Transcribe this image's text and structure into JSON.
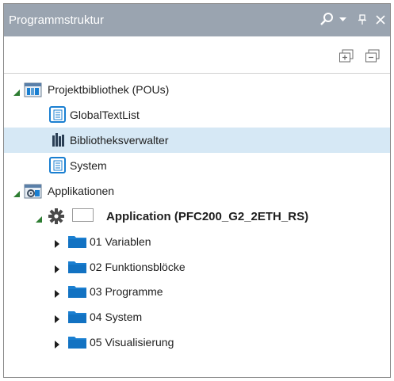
{
  "panel": {
    "title": "Programmstruktur"
  },
  "tree": {
    "library_root": "Projektbibliothek (POUs)",
    "library_children": [
      "GlobalTextList",
      "Bibliotheksverwalter",
      "System"
    ],
    "applications_root": "Applikationen",
    "application": "Application (PFC200_G2_2ETH_RS)",
    "folders": [
      "01 Variablen",
      "02 Funktionsblöcke",
      "03 Programme",
      "04 System",
      "05 Visualisierung"
    ],
    "selected_item": "Bibliotheksverwalter"
  },
  "icons": {
    "title_bar": [
      "search-icon",
      "dropdown-arrow-icon",
      "pin-icon",
      "close-icon"
    ],
    "toolbar": [
      "expand-all-icon",
      "collapse-all-icon"
    ],
    "tree": [
      "library-icon",
      "text-list-icon",
      "library-manager-icon",
      "application-icon",
      "gear-icon",
      "folder-icon"
    ]
  },
  "colors": {
    "title_bar": "#9aa4b0",
    "selection": "#d6e8f5",
    "folder": "#1a7fd1",
    "expander_expanded": "#2e7d32"
  }
}
